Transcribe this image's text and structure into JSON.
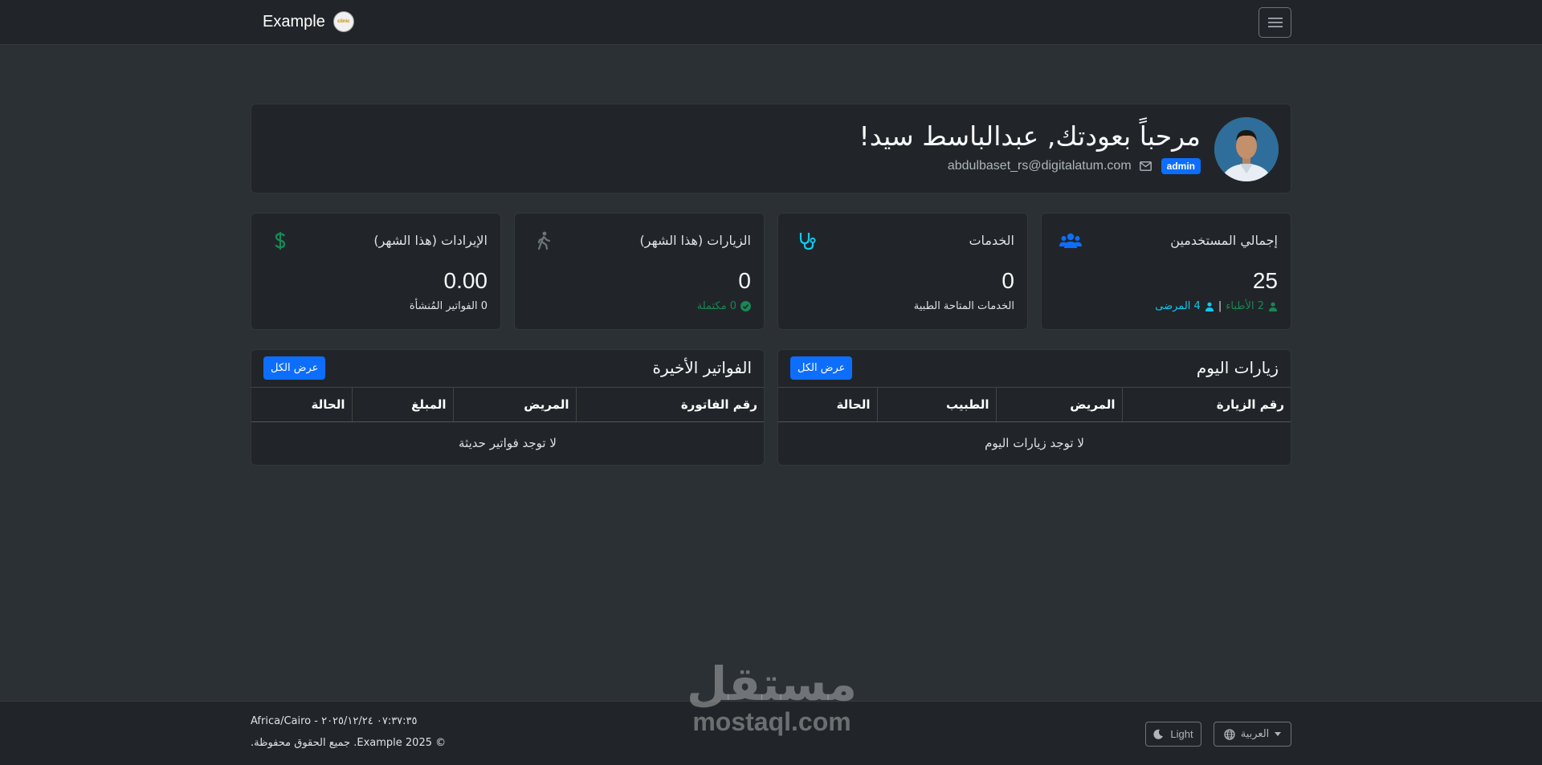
{
  "navbar": {
    "brand": "Example",
    "logo_text": "clinic",
    "menu_icon": "hamburger-icon"
  },
  "welcome": {
    "title": "مرحباً بعودتك, عبدالباسط سيد!",
    "role_badge": "admin",
    "email": "abdulbaset_rs@digitalatum.com",
    "email_icon": "envelope-icon",
    "avatar_icon": "user-avatar"
  },
  "stats": {
    "users": {
      "title": "إجمالي المستخدمين",
      "value": "25",
      "doctors": "2 الأطباء",
      "separator": "|",
      "patients": "4 المرضى",
      "icon": "users-icon",
      "color": "#0d6efd"
    },
    "services": {
      "title": "الخدمات",
      "value": "0",
      "sub": "الخدمات المتاحة الطبية",
      "icon": "stethoscope-icon",
      "color": "#0dcaf0"
    },
    "visits": {
      "title": "الزيارات (هذا الشهر)",
      "value": "0",
      "sub": "0 مكتملة",
      "icon": "walking-icon",
      "color": "#6c757d"
    },
    "revenue": {
      "title": "الإيرادات (هذا الشهر)",
      "value": "0.00",
      "sub": "0 الفواتير المُنشأة",
      "icon": "dollar-icon",
      "color": "#198754"
    }
  },
  "today_visits": {
    "title": "زيارات اليوم",
    "view_all": "عرض الكل",
    "columns": [
      "رقم الزيارة",
      "المريض",
      "الطبيب",
      "الحالة"
    ],
    "empty": "لا توجد زيارات اليوم"
  },
  "recent_invoices": {
    "title": "الفواتير الأخيرة",
    "view_all": "عرض الكل",
    "columns": [
      "رقم الفاتورة",
      "المريض",
      "المبلغ",
      "الحالة"
    ],
    "empty": "لا توجد فواتير حديثة"
  },
  "footer": {
    "datetime": "Africa/Cairo - ٠٧:٣٧:٣٥ ٢٠٢٥/١٢/٢٤",
    "copyright": "© Example 2025. جميع الحقوق محفوظة.",
    "language": "العربية",
    "theme": "Light"
  },
  "watermark": {
    "arabic": "مستقل",
    "latin": "mostaql.com"
  },
  "colors": {
    "accent": "#0d6efd",
    "success": "#198754",
    "info": "#0dcaf0",
    "background": "#2b3035",
    "card": "#212529"
  }
}
